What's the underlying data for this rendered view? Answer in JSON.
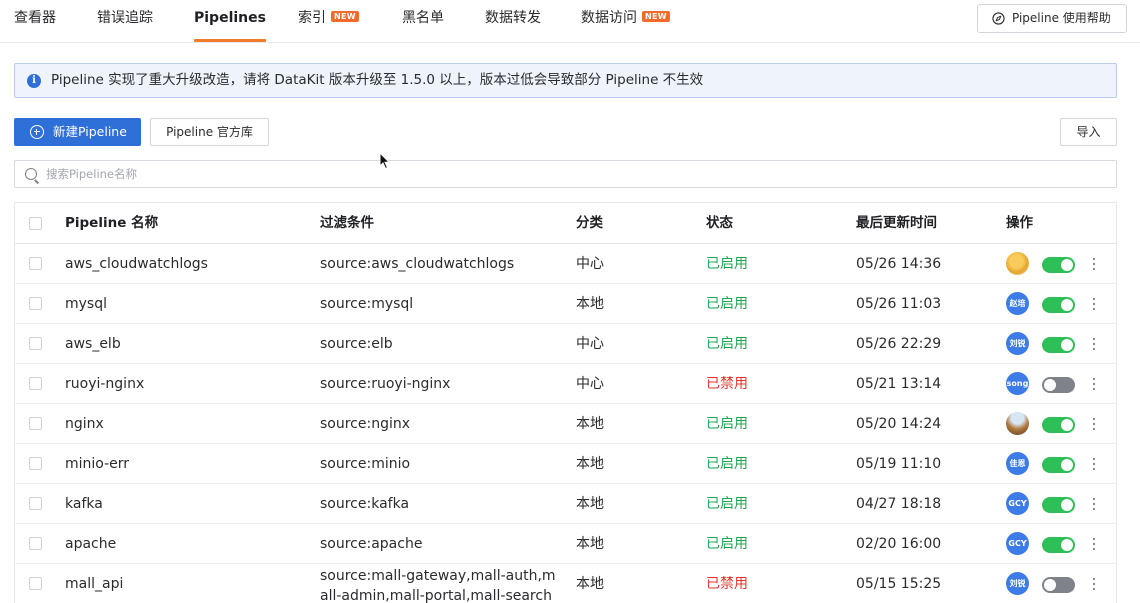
{
  "nav": {
    "tabs": [
      {
        "label": "查看器",
        "badge": ""
      },
      {
        "label": "错误追踪",
        "badge": ""
      },
      {
        "label": "Pipelines",
        "badge": "",
        "active": true
      },
      {
        "label": "索引",
        "badge": "NEW"
      },
      {
        "label": "黑名单",
        "badge": ""
      },
      {
        "label": "数据转发",
        "badge": ""
      },
      {
        "label": "数据访问",
        "badge": "NEW"
      }
    ],
    "help_label": "Pipeline 使用帮助"
  },
  "notice": {
    "text": "Pipeline 实现了重大升级改造，请将 DataKit 版本升级至 1.5.0 以上，版本过低会导致部分 Pipeline 不生效"
  },
  "actions": {
    "new_label": "新建Pipeline",
    "library_label": "Pipeline 官方库",
    "import_label": "导入"
  },
  "search": {
    "placeholder": "搜索Pipeline名称",
    "value": ""
  },
  "table": {
    "headers": {
      "name": "Pipeline 名称",
      "filter": "过滤条件",
      "category": "分类",
      "status": "状态",
      "updated": "最后更新时间",
      "ops": "操作"
    },
    "rows": [
      {
        "name": "aws_cloudwatchlogs",
        "filter": "source:aws_cloudwatchlogs",
        "category": "中心",
        "status": "已启用",
        "enabled": true,
        "updated": "05/26 14:36",
        "avatar": "",
        "avatar_kind": "image-yellow"
      },
      {
        "name": "mysql",
        "filter": "source:mysql",
        "category": "本地",
        "status": "已启用",
        "enabled": true,
        "updated": "05/26 11:03",
        "avatar": "赵培",
        "avatar_kind": "text"
      },
      {
        "name": "aws_elb",
        "filter": "source:elb",
        "category": "中心",
        "status": "已启用",
        "enabled": true,
        "updated": "05/26 22:29",
        "avatar": "刘锐",
        "avatar_kind": "text"
      },
      {
        "name": "ruoyi-nginx",
        "filter": "source:ruoyi-nginx",
        "category": "中心",
        "status": "已禁用",
        "enabled": false,
        "updated": "05/21 13:14",
        "avatar": "song",
        "avatar_kind": "text"
      },
      {
        "name": "nginx",
        "filter": "source:nginx",
        "category": "本地",
        "status": "已启用",
        "enabled": true,
        "updated": "05/20 14:24",
        "avatar": "",
        "avatar_kind": "image-photo"
      },
      {
        "name": "minio-err",
        "filter": "source:minio",
        "category": "本地",
        "status": "已启用",
        "enabled": true,
        "updated": "05/19 11:10",
        "avatar": "佳恩",
        "avatar_kind": "text"
      },
      {
        "name": "kafka",
        "filter": "source:kafka",
        "category": "本地",
        "status": "已启用",
        "enabled": true,
        "updated": "04/27 18:18",
        "avatar": "GCY",
        "avatar_kind": "text"
      },
      {
        "name": "apache",
        "filter": "source:apache",
        "category": "本地",
        "status": "已启用",
        "enabled": true,
        "updated": "02/20 16:00",
        "avatar": "GCY",
        "avatar_kind": "text"
      },
      {
        "name": "mall_api",
        "filter": "source:mall-gateway,mall-auth,mall-admin,mall-portal,mall-search",
        "category": "本地",
        "status": "已禁用",
        "enabled": false,
        "updated": "05/15 15:25",
        "avatar": "刘锐",
        "avatar_kind": "text"
      }
    ]
  },
  "colors": {
    "accent_tab": "#f07c29",
    "primary": "#2e6fd8",
    "status_on": "#22a352",
    "status_off": "#e5352b",
    "toggle_on": "#2fbf59",
    "toggle_off": "#7f8288",
    "badge_new": "#f26b2a"
  },
  "icons": [
    "info-icon",
    "compass-icon",
    "plus-circle-icon",
    "search-icon",
    "more-vertical-icon"
  ]
}
